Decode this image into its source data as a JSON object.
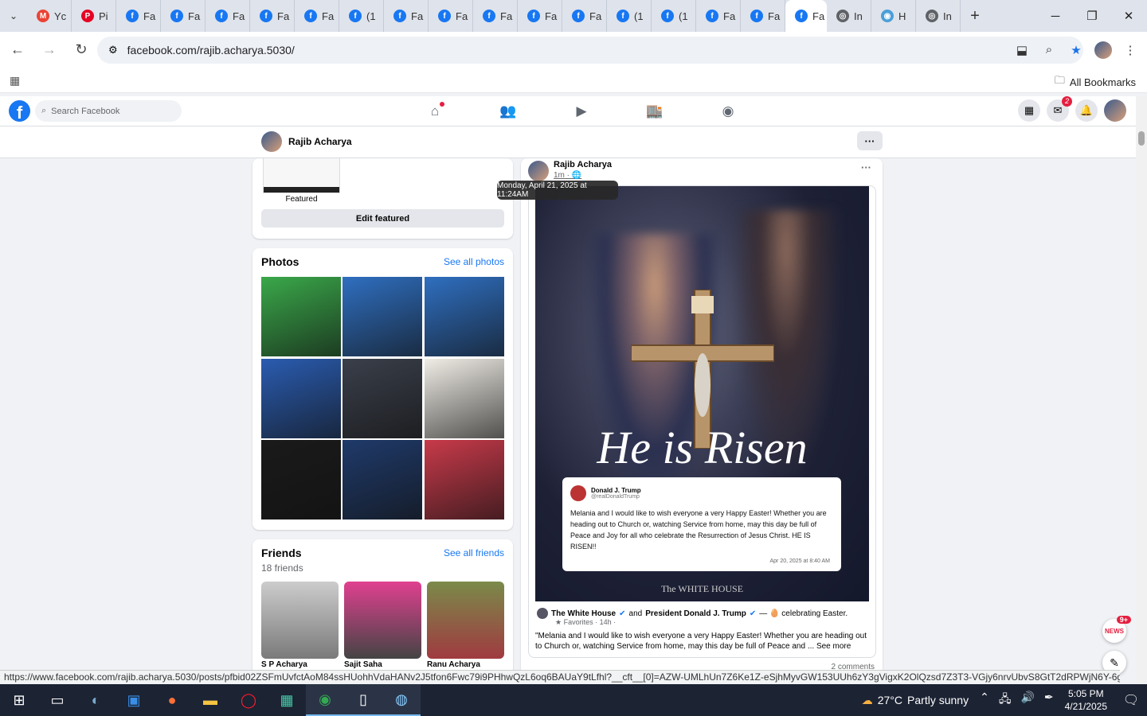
{
  "browser": {
    "tabs": [
      {
        "label": "Yc",
        "icon": "gmail-icon",
        "color": "#ea4335",
        "glyph": "M"
      },
      {
        "label": "Pi",
        "icon": "pinterest-icon",
        "color": "#e60023",
        "glyph": "P"
      },
      {
        "label": "Fa",
        "icon": "facebook-icon",
        "color": "#1877f2",
        "glyph": "f"
      },
      {
        "label": "Fa",
        "icon": "facebook-icon",
        "color": "#1877f2",
        "glyph": "f"
      },
      {
        "label": "Fa",
        "icon": "facebook-icon",
        "color": "#1877f2",
        "glyph": "f"
      },
      {
        "label": "Fa",
        "icon": "facebook-icon",
        "color": "#1877f2",
        "glyph": "f"
      },
      {
        "label": "Fa",
        "icon": "facebook-icon",
        "color": "#1877f2",
        "glyph": "f"
      },
      {
        "label": "(1",
        "icon": "facebook-icon",
        "color": "#1877f2",
        "glyph": "f"
      },
      {
        "label": "Fa",
        "icon": "facebook-icon",
        "color": "#1877f2",
        "glyph": "f"
      },
      {
        "label": "Fa",
        "icon": "facebook-icon",
        "color": "#1877f2",
        "glyph": "f"
      },
      {
        "label": "Fa",
        "icon": "facebook-icon",
        "color": "#1877f2",
        "glyph": "f"
      },
      {
        "label": "Fa",
        "icon": "facebook-icon",
        "color": "#1877f2",
        "glyph": "f"
      },
      {
        "label": "Fa",
        "icon": "facebook-icon",
        "color": "#1877f2",
        "glyph": "f"
      },
      {
        "label": "(1",
        "icon": "facebook-icon",
        "color": "#1877f2",
        "glyph": "f"
      },
      {
        "label": "(1",
        "icon": "facebook-icon",
        "color": "#1877f2",
        "glyph": "f"
      },
      {
        "label": "Fa",
        "icon": "facebook-icon",
        "color": "#1877f2",
        "glyph": "f"
      },
      {
        "label": "Fa",
        "icon": "facebook-icon",
        "color": "#1877f2",
        "glyph": "f"
      }
    ],
    "active_tab_label": "Fa",
    "after_tabs": [
      {
        "label": "In",
        "icon": "globe-icon",
        "color": "#5f6368",
        "glyph": "◎"
      },
      {
        "label": "H",
        "icon": "web-icon",
        "color": "#4a9fd8",
        "glyph": "◉"
      },
      {
        "label": "In",
        "icon": "globe-icon",
        "color": "#5f6368",
        "glyph": "◎"
      }
    ],
    "url": "facebook.com/rajib.acharya.5030/",
    "all_bookmarks": "All Bookmarks"
  },
  "facebook": {
    "search_placeholder": "Search Facebook",
    "messenger_badge": "2",
    "profile_name": "Rajib Acharya",
    "featured_label": "Featured",
    "edit_featured": "Edit featured",
    "photos_title": "Photos",
    "see_all_photos": "See all photos",
    "friends_title": "Friends",
    "see_all_friends": "See all friends",
    "friends_count": "18 friends",
    "friends": [
      "S P Acharya",
      "Sajit Saha",
      "Ranu Acharya"
    ]
  },
  "post": {
    "author": "Rajib Acharya",
    "time": "1m",
    "tooltip": "Monday, April 21, 2025 at 11:24AM",
    "image_headline": "He is Risen",
    "tweet_name": "Donald J. Trump",
    "tweet_handle": "@realDonaldTrump",
    "tweet_body": "Melania and I would like to wish everyone a very Happy Easter! Whether you are heading out to Church or, watching Service from home, may this day be full of Peace and Joy for all who celebrate the Resurrection of Jesus Christ. HE IS RISEN!!",
    "tweet_date": "Apr 20, 2025 at 8:40 AM",
    "watermark": "The WHITE HOUSE",
    "shared_page": "The White House",
    "and": "and",
    "shared_page2": "President Donald J. Trump",
    "feeling": "— 🥚 celebrating Easter.",
    "shared_meta": "Favorites · 14h ·",
    "shared_text": "\"Melania and I would like to wish everyone a very Happy Easter! Whether you are heading out to Church or, watching Service from home, may this day be full of Peace and ... See more",
    "comments": "2 comments"
  },
  "chat_badge": "9+",
  "status_url": "https://www.facebook.com/rajib.acharya.5030/posts/pfbid02ZSFmUvfctAoM84ssHUohhVdaHANv2J5tfon6Fwc79i9PHhwQzL6oq6BAUaY9tLfhl?__cft__[0]=AZW-UMLhUn7Z6Ke1Z-eSjhMyvGW153UUh6zY3gVigxK2OlQzsd7Z3T3-VGjy6nrvUbvS8GtT2dRPWjN6Y-6gluxz...",
  "taskbar": {
    "weather_temp": "27°C",
    "weather_text": "Partly sunny",
    "time": "5:05 PM",
    "date": "4/21/2025"
  },
  "photo_colors": [
    "#3aa84a",
    "#2f6fc0",
    "#2f6fc0",
    "#2a5cb0",
    "#3a3f4a",
    "#f0ede6",
    "#1a1a1a",
    "#1f3a6a",
    "#c83a4a"
  ]
}
